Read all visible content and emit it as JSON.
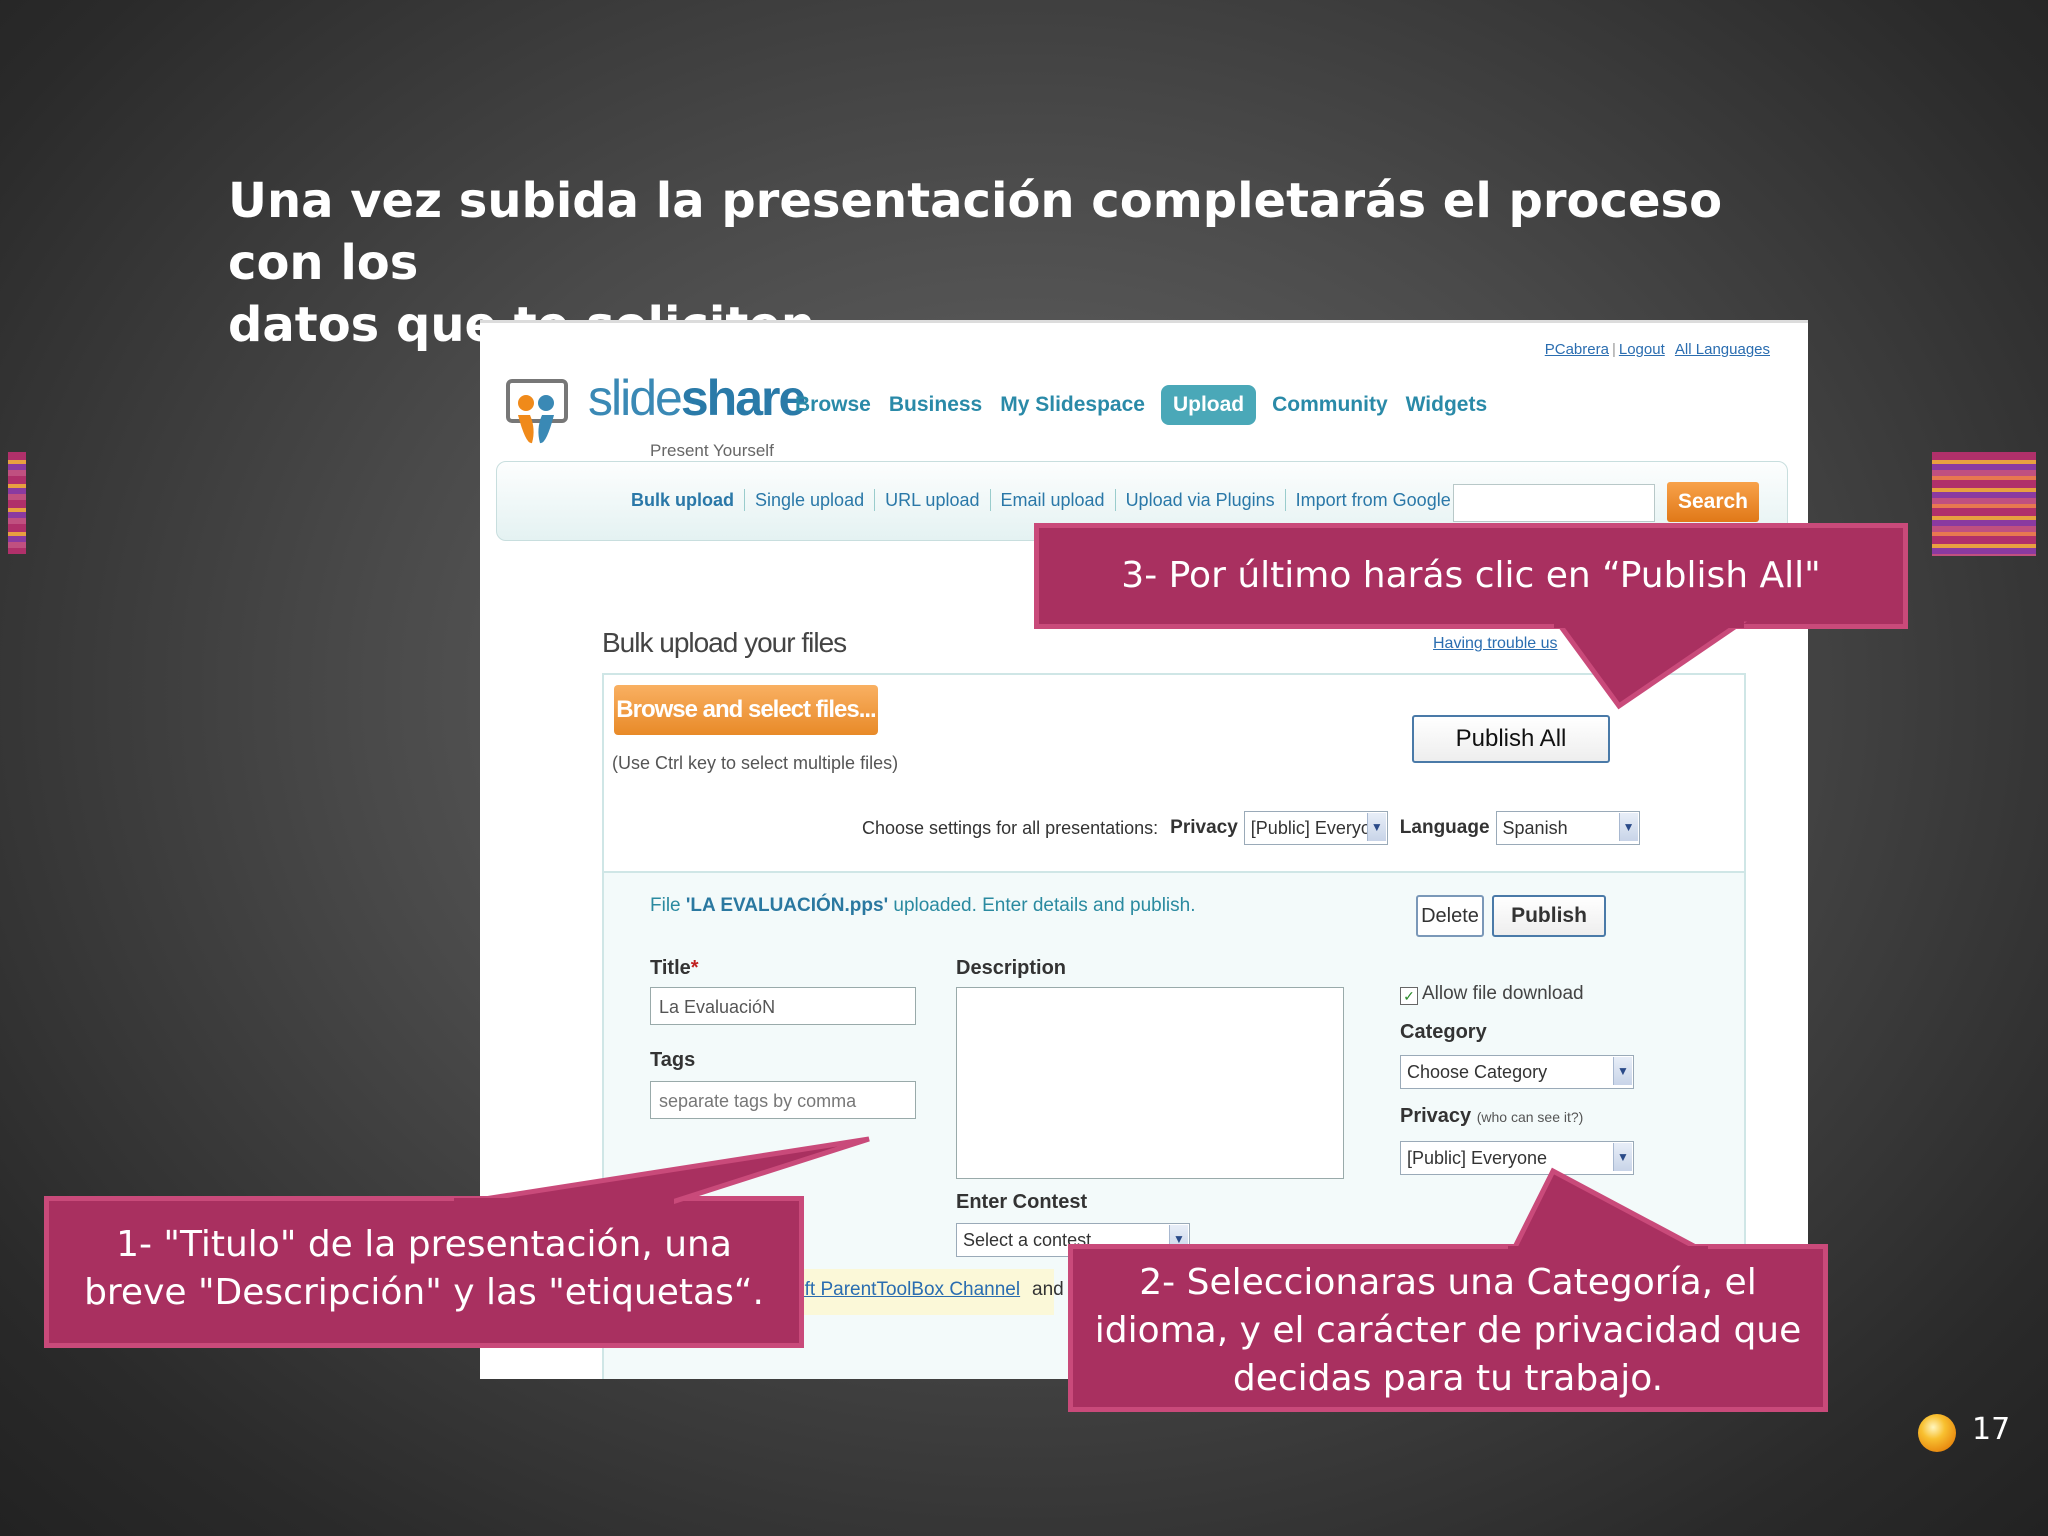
{
  "slide": {
    "heading_line1": "Una vez subida la presentación completarás el proceso con los",
    "heading_line2": "datos que te soliciten.",
    "page_number": "17"
  },
  "site": {
    "logo_prefix": "slide",
    "logo_suffix": "share",
    "tagline": "Present Yourself",
    "user_links": [
      "PCabrera",
      "Logout",
      "All Languages"
    ],
    "main_nav": [
      {
        "label": "Browse",
        "active": false
      },
      {
        "label": "Business",
        "active": false
      },
      {
        "label": "My Slidespace",
        "active": false
      },
      {
        "label": "Upload",
        "active": true
      },
      {
        "label": "Community",
        "active": false
      },
      {
        "label": "Widgets",
        "active": false
      }
    ],
    "sub_nav": [
      "Bulk upload",
      "Single upload",
      "URL upload",
      "Email upload",
      "Upload via Plugins",
      "Import from Google Docs"
    ],
    "search_value": "",
    "search_button": "Search"
  },
  "upload": {
    "title": "Bulk upload your files",
    "trouble_link": "Having trouble us",
    "browse_button": "Browse and select files...",
    "ctrl_hint": "(Use Ctrl key to select multiple files)",
    "publish_all": "Publish All",
    "settings_label": "Choose settings for all presentations:",
    "privacy_label": "Privacy",
    "privacy_value": "[Public] Everyo",
    "language_label": "Language",
    "language_value": "Spanish"
  },
  "file": {
    "msg_prefix": "File ",
    "file_name": "'LA EVALUACIÓN.pps'",
    "msg_suffix": " uploaded. Enter details and publish.",
    "delete_button": "Delete",
    "publish_button": "Publish",
    "title_label": "Title",
    "title_required": "*",
    "title_value": "La   EvaluacióN",
    "tags_label": "Tags",
    "tags_placeholder": "separate tags by comma",
    "description_label": "Description",
    "description_value": "",
    "allow_download_label": "Allow file download",
    "allow_download_checked": "✓",
    "category_label": "Category",
    "category_value": "Choose Category",
    "privacy_label": "Privacy",
    "privacy_note": "(who can see it?)",
    "privacy_value": "[Public] Everyone",
    "contest_label": "Enter Contest",
    "contest_value": "Select a contest",
    "partial_link": "osoft ParentToolBox Channel",
    "partial_and": "and"
  },
  "callouts": {
    "step3": "3- Por último harás clic en “Publish All\"",
    "step1_line1": "1- \"Titulo\" de la presentación, una",
    "step1_line2": "breve \"Descripción\" y las \"etiquetas“.",
    "step2_line1": "2- Seleccionaras una Categoría, el",
    "step2_line2": "idioma, y el carácter de privacidad que",
    "step2_line3": "decidas para tu trabajo."
  },
  "colors": {
    "callout_fill": "#a93060",
    "callout_border": "#c94a7a",
    "link_blue": "#2a6db0",
    "accent_orange": "#e88a28",
    "nav_teal": "#2a8aa8"
  }
}
